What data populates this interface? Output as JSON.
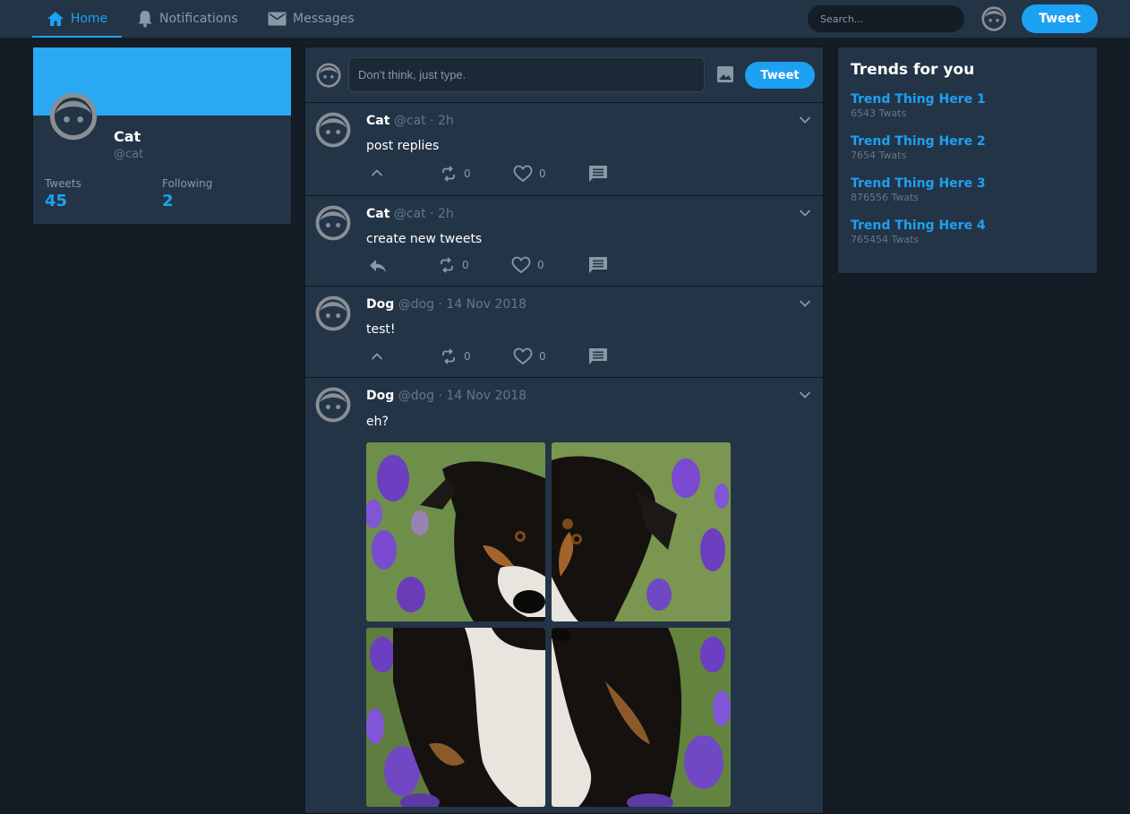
{
  "nav": {
    "items": [
      {
        "label": "Home",
        "icon": "home-icon",
        "active": true
      },
      {
        "label": "Notifications",
        "icon": "bell-icon",
        "active": false
      },
      {
        "label": "Messages",
        "icon": "envelope-icon",
        "active": false
      }
    ],
    "search_placeholder": "Search...",
    "tweet_label": "Tweet"
  },
  "profile": {
    "name": "Cat",
    "handle": "@cat",
    "tweets_label": "Tweets",
    "tweets_count": "45",
    "following_label": "Following",
    "following_count": "2"
  },
  "compose": {
    "placeholder": "Don't think, just type.",
    "tweet_label": "Tweet"
  },
  "tweets": [
    {
      "name": "Cat",
      "handle": "@cat",
      "dot": "·",
      "time": "2h",
      "text": "post replies",
      "reply_icon": "chevron-up-icon",
      "retweets": "0",
      "likes": "0"
    },
    {
      "name": "Cat",
      "handle": "@cat",
      "dot": "·",
      "time": "2h",
      "text": "create new tweets",
      "reply_icon": "reply-arrow-icon",
      "retweets": "0",
      "likes": "0"
    },
    {
      "name": "Dog",
      "handle": "@dog",
      "dot": "·",
      "time": "14 Nov 2018",
      "text": "test!",
      "reply_icon": "chevron-up-icon",
      "retweets": "0",
      "likes": "0"
    },
    {
      "name": "Dog",
      "handle": "@dog",
      "dot": "·",
      "time": "14 Nov 2018",
      "text": "eh?",
      "photos": [
        "dog-photo-1",
        "dog-photo-2",
        "dog-photo-3",
        "dog-photo-4"
      ]
    }
  ],
  "trends": {
    "title": "Trends for you",
    "items": [
      {
        "name": "Trend Thing Here 1",
        "count": "6543 Twats"
      },
      {
        "name": "Trend Thing Here 2",
        "count": "7654 Twats"
      },
      {
        "name": "Trend Thing Here 3",
        "count": "876556 Twats"
      },
      {
        "name": "Trend Thing Here 4",
        "count": "765454 Twats"
      }
    ]
  },
  "colors": {
    "accent": "#1da1f2",
    "background": "#141d26",
    "panel": "#243447",
    "muted": "#8899a6"
  }
}
